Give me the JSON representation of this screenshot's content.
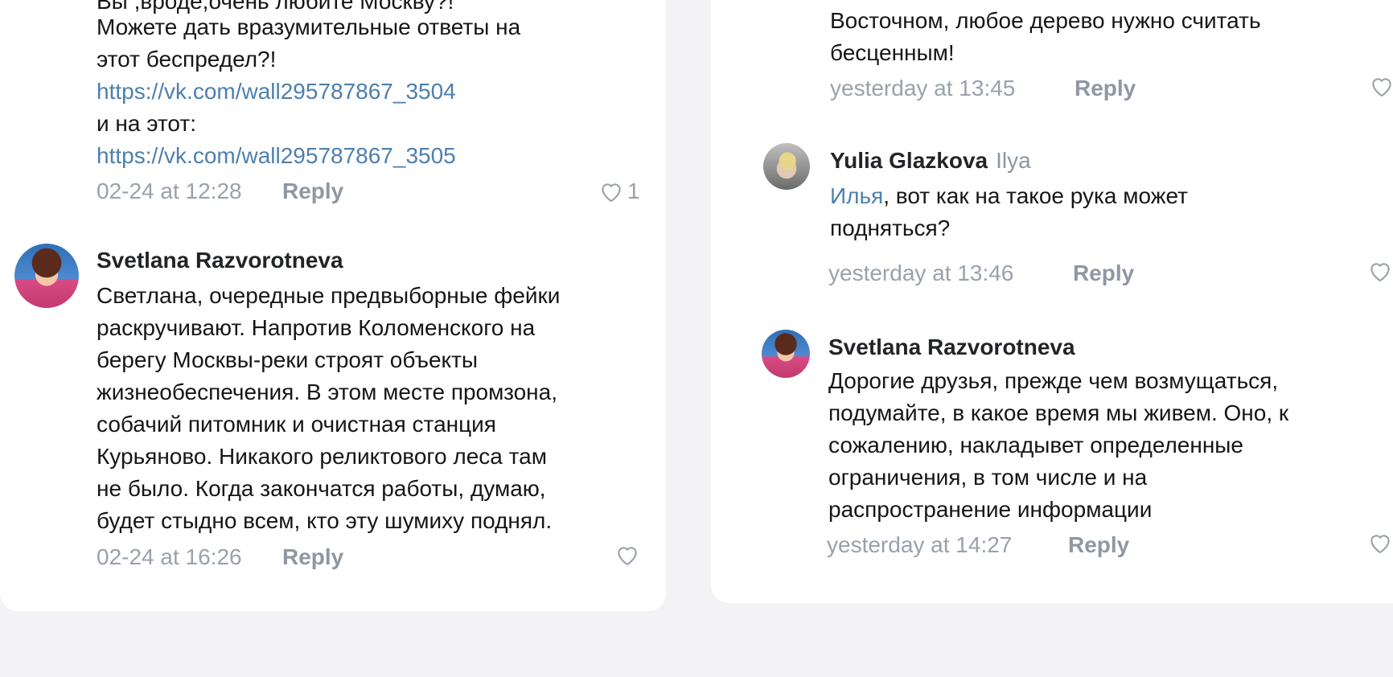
{
  "left_column": {
    "top_comment": {
      "cut_line": "Вы ,вроде,очень любите Москву?!",
      "lines": [
        "Можете дать вразумительные ответы  на",
        "этот беспредел?!"
      ],
      "link1": "https://vk.com/wall295787867_3504",
      "middle_line": "и на этот:",
      "link2": "https://vk.com/wall295787867_3505",
      "time": "02-24 at 12:28",
      "reply": "Reply",
      "likes": "1"
    },
    "svetlana_comment": {
      "author": "Svetlana Razvorotneva",
      "lines": [
        "Светлана, очередные предвыборные фейки",
        "раскручивают. Напротив Коломенского на",
        "берегу Москвы-реки строят объекты",
        "жизнеобеспечения. В этом месте промзона,",
        "собачий питомник и очистная станция",
        "Курьяново. Никакого реликтового леса там",
        "не было. Когда закончатся работы, думаю,",
        "будет стыдно всем, кто эту шумиху поднял."
      ],
      "time": "02-24 at 16:26",
      "reply": "Reply"
    }
  },
  "right_column": {
    "top_comment": {
      "lines": [
        "Восточном, любое дерево нужно считать",
        "бесценным!"
      ],
      "time": "yesterday at 13:45",
      "reply": "Reply"
    },
    "yulia_comment": {
      "author": "Yulia Glazkova",
      "reply_to": "Ilya",
      "mention": "Илья",
      "first_line_rest": ", вот как на такое рука может",
      "second_line": "подняться?",
      "time": "yesterday at 13:46",
      "reply": "Reply"
    },
    "svetlana_comment": {
      "author": "Svetlana Razvorotneva",
      "lines": [
        "Дорогие друзья, прежде чем возмущаться,",
        "подумайте, в какое время мы живем. Оно, к",
        "сожалению, накладывет определенные",
        "ограничения, в том числе и на",
        "распространение информации"
      ],
      "time": "yesterday at 14:27",
      "reply": "Reply"
    }
  },
  "icons": {
    "like": "heart-outline-icon"
  }
}
